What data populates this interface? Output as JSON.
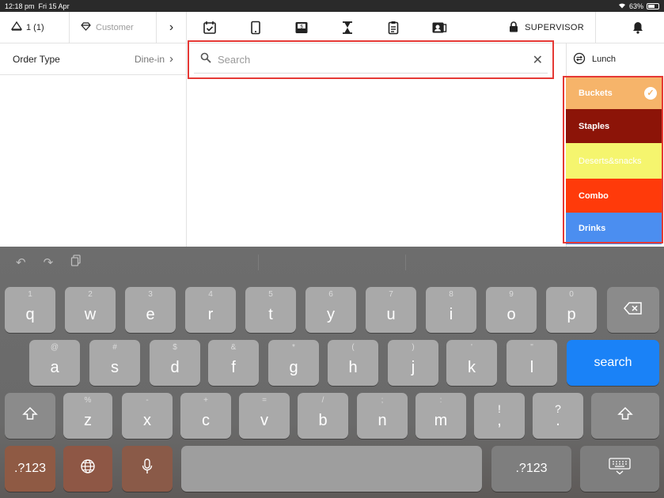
{
  "status": {
    "time": "12:18 pm",
    "date": "Fri 15 Apr",
    "battery": "63%"
  },
  "topbar": {
    "table_label": "1 (1)",
    "customer_label": "Customer",
    "chevron": "›",
    "supervisor_label": "SUPERVISOR",
    "icons": [
      "calendar-check-icon",
      "tablet-icon",
      "inbox-icon",
      "hourglass-icon",
      "clipboard-icon",
      "user-card-icon"
    ]
  },
  "left": {
    "order_type_label": "Order Type",
    "order_type_value": "Dine-in"
  },
  "search": {
    "placeholder": "Search",
    "value": ""
  },
  "menu": {
    "selector_label": "Lunch"
  },
  "categories": [
    {
      "label": "Buckets",
      "color": "#f6b46a",
      "selected": true
    },
    {
      "label": "Staples",
      "color": "#8c1408",
      "selected": false
    },
    {
      "label": "Deserts&snacks",
      "color": "#f5f56e",
      "selected": false
    },
    {
      "label": "Combo",
      "color": "#ff3a0a",
      "selected": false
    },
    {
      "label": "Drinks",
      "color": "#4b8ef0",
      "selected": false
    }
  ],
  "keyboard": {
    "row1": [
      {
        "alt": "1",
        "key": "q"
      },
      {
        "alt": "2",
        "key": "w"
      },
      {
        "alt": "3",
        "key": "e"
      },
      {
        "alt": "4",
        "key": "r"
      },
      {
        "alt": "5",
        "key": "t"
      },
      {
        "alt": "6",
        "key": "y"
      },
      {
        "alt": "7",
        "key": "u"
      },
      {
        "alt": "8",
        "key": "i"
      },
      {
        "alt": "9",
        "key": "o"
      },
      {
        "alt": "0",
        "key": "p"
      }
    ],
    "row2": [
      {
        "alt": "@",
        "key": "a"
      },
      {
        "alt": "#",
        "key": "s"
      },
      {
        "alt": "$",
        "key": "d"
      },
      {
        "alt": "&",
        "key": "f"
      },
      {
        "alt": "*",
        "key": "g"
      },
      {
        "alt": "(",
        "key": "h"
      },
      {
        "alt": ")",
        "key": "j"
      },
      {
        "alt": "'",
        "key": "k"
      },
      {
        "alt": "\"",
        "key": "l"
      }
    ],
    "row3": [
      {
        "alt": "%",
        "key": "z"
      },
      {
        "alt": "-",
        "key": "x"
      },
      {
        "alt": "+",
        "key": "c"
      },
      {
        "alt": "=",
        "key": "v"
      },
      {
        "alt": "/",
        "key": "b"
      },
      {
        "alt": ";",
        "key": "n"
      },
      {
        "alt": ":",
        "key": "m"
      },
      {
        "alt": "!",
        "key": ","
      },
      {
        "alt": "?",
        "key": "."
      }
    ],
    "search_label": "search",
    "numbers_label": ".?123",
    "numbers_label_right": ".?123"
  }
}
